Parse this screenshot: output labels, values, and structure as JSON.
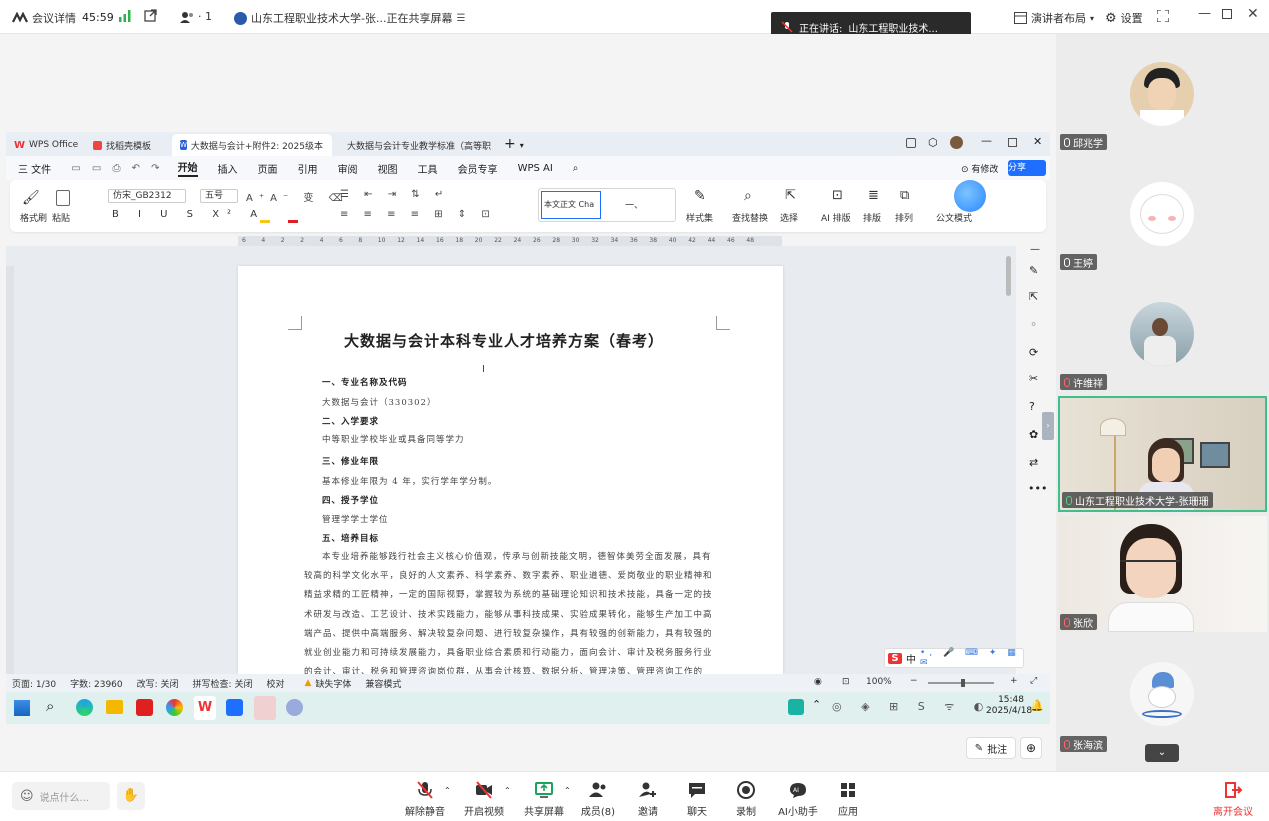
{
  "topbar": {
    "meeting_details": "会议详情",
    "timer": "45:59",
    "participants_count": "· 1",
    "sharing_title": "山东工程职业技术大学-张...正在共享屏幕",
    "speaker_prefix": "正在讲话:",
    "speaker_name": "山东工程职业技术...",
    "layout_label": "演讲者布局",
    "settings_label": "设置",
    "accent": "#1e6fff"
  },
  "wps": {
    "tabs": [
      {
        "label": "WPS Office"
      },
      {
        "label": "找稻壳模板"
      },
      {
        "label": "大数据与会计+附件2: 2025级本"
      },
      {
        "label": "大数据与会计专业教学标准（高等职"
      }
    ],
    "menu": [
      "三 文件",
      "开始",
      "插入",
      "页面",
      "引用",
      "审阅",
      "视图",
      "工具",
      "会员专享",
      "WPS AI"
    ],
    "share_btn": "分享",
    "revise_btn": "有修改",
    "font_name": "仿宋_GB2312",
    "font_size": "五号",
    "ribbon": {
      "format_painter": "格式刷",
      "paste": "粘贴",
      "style_preview": "本文正文",
      "style_en": "Cha",
      "style_heading": "一、",
      "styles": "样式集",
      "find_replace": "查找替换",
      "select": "选择",
      "ai_layout": "AI 排版",
      "layout": "排版",
      "arrange": "排列",
      "official": "公文模式"
    },
    "ruler_ticks": [
      "6",
      "4",
      "2",
      "2",
      "4",
      "6",
      "8",
      "10",
      "12",
      "14",
      "16",
      "18",
      "20",
      "22",
      "24",
      "26",
      "28",
      "30",
      "32",
      "34",
      "36",
      "38",
      "40",
      "42",
      "44",
      "46",
      "48"
    ],
    "doc": {
      "title": "大数据与会计本科专业人才培养方案（春考）",
      "lines": [
        {
          "text": "一、专业名称及代码",
          "head": true
        },
        {
          "text": "大数据与会计（330302）",
          "head": false
        },
        {
          "text": "二、入学要求",
          "head": true
        },
        {
          "text": "中等职业学校毕业或具备同等学力",
          "head": false
        },
        {
          "text": "三、修业年限",
          "head": true
        },
        {
          "text": "基本修业年限为 4 年，实行学年学分制。",
          "head": false
        },
        {
          "text": "四、授予学位",
          "head": true
        },
        {
          "text": "管理学学士学位",
          "head": false
        },
        {
          "text": "五、培养目标",
          "head": true
        }
      ],
      "paragraph": [
        "本专业培养能够践行社会主义核心价值观，传承与创新技能文明，德智体美劳全面发展，具有",
        "较高的科学文化水平，良好的人文素养、科学素养、数字素养、职业道德、爱岗敬业的职业精神和",
        "精益求精的工匠精神，一定的国际视野，掌握较为系统的基础理论知识和技术技能，具备一定的技",
        "术研发与改造、工艺设计、技术实践能力，能够从事科技成果、实验成果转化，能够生产加工中高",
        "端产品、提供中高端服务、解决较复杂问题、进行较复杂操作，具有较强的创新能力，具有较强的",
        "就业创业能力和可持续发展能力，具备职业综合素质和行动能力，面向会计、审计及税务服务行业",
        "的会计、审计、税务和管理咨询岗位群，从事会计核算、数据分析、管理决策、管理咨询工作的"
      ]
    },
    "status": {
      "page": "页面: 1/30",
      "words": "字数: 23960",
      "revise": "改写: 关闭",
      "spell": "拼写检查: 关闭",
      "proof": "校对",
      "missing_font": "缺失字体",
      "compat": "兼容模式",
      "zoom": "100%"
    },
    "ime_label": "中",
    "clock_time": "15:48",
    "clock_date": "2025/4/18"
  },
  "annotate_btn": "批注",
  "participants": [
    {
      "name": "邱兆学"
    },
    {
      "name": "王婷"
    },
    {
      "name": "许维祥"
    },
    {
      "name": "山东工程职业技术大学-张珊珊"
    },
    {
      "name": "张欣"
    },
    {
      "name": "张海滨"
    }
  ],
  "bottombar": {
    "chat_placeholder": "说点什么...",
    "unmute": "解除静音",
    "video": "开启视频",
    "share": "共享屏幕",
    "members": "成员(8)",
    "invite": "邀请",
    "chat": "聊天",
    "record": "录制",
    "ai_assistant": "AI小助手",
    "apps": "应用",
    "leave": "离开会议"
  }
}
